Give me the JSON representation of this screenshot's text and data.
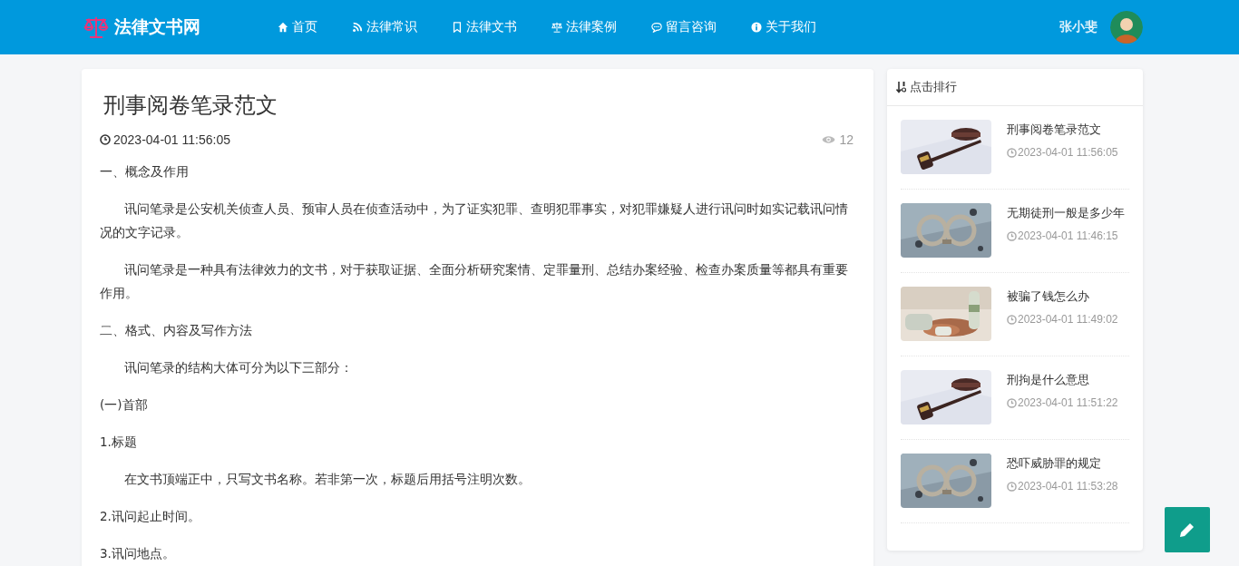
{
  "header": {
    "logo": "法律文书网",
    "nav": [
      {
        "kind": "home",
        "label": "首页"
      },
      {
        "kind": "rss",
        "label": "法律常识"
      },
      {
        "kind": "bookmark",
        "label": "法律文书"
      },
      {
        "kind": "scale",
        "label": "法律案例"
      },
      {
        "kind": "chat",
        "label": "留言咨询"
      },
      {
        "kind": "info",
        "label": "关于我们"
      }
    ],
    "user": {
      "name": "张小斐"
    }
  },
  "article": {
    "title": "刑事阅卷笔录范文",
    "date": "2023-04-01 11:56:05",
    "views": "12",
    "paragraphs": [
      {
        "indent": false,
        "text": "一、概念及作用"
      },
      {
        "indent": true,
        "text": "讯问笔录是公安机关侦查人员、预审人员在侦查活动中，为了证实犯罪、查明犯罪事实，对犯罪嫌疑人进行讯问时如实记载讯问情况的文字记录。"
      },
      {
        "indent": true,
        "text": "讯问笔录是一种具有法律效力的文书，对于获取证据、全面分析研究案情、定罪量刑、总结办案经验、检查办案质量等都具有重要作用。"
      },
      {
        "indent": false,
        "text": "二、格式、内容及写作方法"
      },
      {
        "indent": true,
        "text": "讯问笔录的结构大体可分为以下三部分："
      },
      {
        "indent": false,
        "text": "(一)首部"
      },
      {
        "indent": false,
        "text": "1.标题"
      },
      {
        "indent": true,
        "text": "在文书顶端正中，只写文书名称。若非第一次，标题后用括号注明次数。"
      },
      {
        "indent": false,
        "text": "2.讯问起止时间。"
      },
      {
        "indent": false,
        "text": "3.讯问地点。"
      }
    ]
  },
  "sidebar": {
    "title": "点击排行",
    "items": [
      {
        "title": "刑事阅卷笔录范文",
        "date": "2023-04-01 11:56:05"
      },
      {
        "title": "无期徒刑一般是多少年",
        "date": "2023-04-01 11:46:15"
      },
      {
        "title": "被骗了钱怎么办",
        "date": "2023-04-01 11:49:02"
      },
      {
        "title": "刑拘是什么意思",
        "date": "2023-04-01 11:51:22"
      },
      {
        "title": "恐吓威胁罪的规定",
        "date": "2023-04-01 11:53:28"
      }
    ]
  }
}
